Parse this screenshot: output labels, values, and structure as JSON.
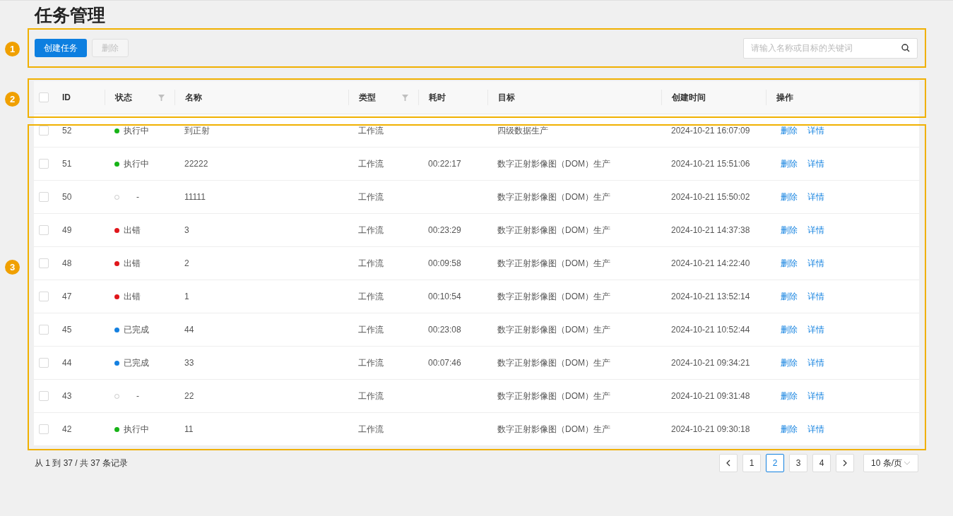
{
  "title": "任务管理",
  "toolbar": {
    "create_button": "创建任务",
    "delete_button": {
      "label": "删除",
      "disabled": true
    },
    "search": {
      "placeholder": "请输入名称或目标的关键词"
    }
  },
  "table": {
    "select_all": {
      "checked": false
    },
    "columns": [
      {
        "label": "ID",
        "filter": false
      },
      {
        "label": "状态",
        "filter": true
      },
      {
        "label": "名称",
        "filter": false
      },
      {
        "label": "类型",
        "filter": true
      },
      {
        "label": "耗时",
        "filter": false
      },
      {
        "label": "目标",
        "filter": false
      },
      {
        "label": "创建时间",
        "filter": false
      },
      {
        "label": "操作",
        "filter": false
      }
    ],
    "rows": [
      {
        "checked": false,
        "id": "52",
        "status": {
          "text": "执行中",
          "color": "#17b317",
          "hollow": false
        },
        "name": "到正射",
        "type": "工作流",
        "duration": "",
        "target": "四级数据生产",
        "created": "2024-10-21 16:07:09",
        "actions": [
          "删除",
          "详情"
        ]
      },
      {
        "checked": false,
        "id": "51",
        "status": {
          "text": "执行中",
          "color": "#17b317",
          "hollow": false
        },
        "name": "22222",
        "type": "工作流",
        "duration": "00:22:17",
        "target": "数字正射影像图（DOM）生产",
        "created": "2024-10-21 15:51:06",
        "actions": [
          "删除",
          "详情"
        ]
      },
      {
        "checked": false,
        "id": "50",
        "status": {
          "text": "-",
          "color": "#c8c8c8",
          "hollow": true
        },
        "name": "11111",
        "type": "工作流",
        "duration": "",
        "target": "数字正射影像图（DOM）生产",
        "created": "2024-10-21 15:50:02",
        "actions": [
          "删除",
          "详情"
        ]
      },
      {
        "checked": false,
        "id": "49",
        "status": {
          "text": "出错",
          "color": "#e0161b",
          "hollow": false
        },
        "name": "3",
        "type": "工作流",
        "duration": "00:23:29",
        "target": "数字正射影像图（DOM）生产",
        "created": "2024-10-21 14:37:38",
        "actions": [
          "删除",
          "详情"
        ]
      },
      {
        "checked": false,
        "id": "48",
        "status": {
          "text": "出错",
          "color": "#e0161b",
          "hollow": false
        },
        "name": "2",
        "type": "工作流",
        "duration": "00:09:58",
        "target": "数字正射影像图（DOM）生产",
        "created": "2024-10-21 14:22:40",
        "actions": [
          "删除",
          "详情"
        ]
      },
      {
        "checked": false,
        "id": "47",
        "status": {
          "text": "出错",
          "color": "#e0161b",
          "hollow": false
        },
        "name": "1",
        "type": "工作流",
        "duration": "00:10:54",
        "target": "数字正射影像图（DOM）生产",
        "created": "2024-10-21 13:52:14",
        "actions": [
          "删除",
          "详情"
        ]
      },
      {
        "checked": false,
        "id": "45",
        "status": {
          "text": "已完成",
          "color": "#1480e0",
          "hollow": false
        },
        "name": "44",
        "type": "工作流",
        "duration": "00:23:08",
        "target": "数字正射影像图（DOM）生产",
        "created": "2024-10-21 10:52:44",
        "actions": [
          "删除",
          "详情"
        ]
      },
      {
        "checked": false,
        "id": "44",
        "status": {
          "text": "已完成",
          "color": "#1480e0",
          "hollow": false
        },
        "name": "33",
        "type": "工作流",
        "duration": "00:07:46",
        "target": "数字正射影像图（DOM）生产",
        "created": "2024-10-21 09:34:21",
        "actions": [
          "删除",
          "详情"
        ]
      },
      {
        "checked": false,
        "id": "43",
        "status": {
          "text": "-",
          "color": "#c8c8c8",
          "hollow": true
        },
        "name": "22",
        "type": "工作流",
        "duration": "",
        "target": "数字正射影像图（DOM）生产",
        "created": "2024-10-21 09:31:48",
        "actions": [
          "删除",
          "详情"
        ]
      },
      {
        "checked": false,
        "id": "42",
        "status": {
          "text": "执行中",
          "color": "#17b317",
          "hollow": false
        },
        "name": "11",
        "type": "工作流",
        "duration": "",
        "target": "数字正射影像图（DOM）生产",
        "created": "2024-10-21 09:30:18",
        "actions": [
          "删除",
          "详情"
        ]
      }
    ]
  },
  "footer": {
    "summary": "从 1 到 37 / 共 37 条记录",
    "pages": [
      {
        "label": "1",
        "selected": false
      },
      {
        "label": "2",
        "selected": true
      },
      {
        "label": "3",
        "selected": false
      },
      {
        "label": "4",
        "selected": false
      }
    ],
    "page_size": "10 条/页"
  },
  "annotations": [
    "1",
    "2",
    "3"
  ]
}
